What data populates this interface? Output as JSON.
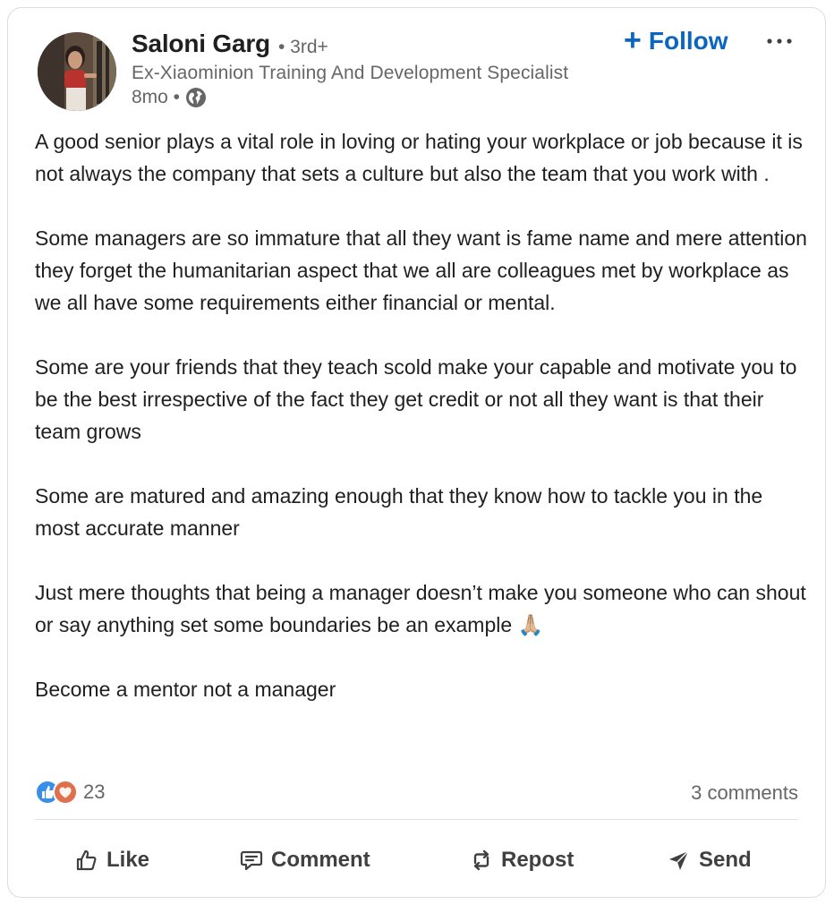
{
  "author": {
    "name": "Saloni Garg",
    "degree": "• 3rd+",
    "headline": "Ex-Xiaominion Training And Development Specialist",
    "time": "8mo •",
    "visibility_icon": "globe-icon"
  },
  "follow": {
    "label": "Follow",
    "icon": "plus-icon"
  },
  "more": {
    "icon": "ellipsis-icon"
  },
  "post": {
    "paragraphs": [
      "A good senior plays a vital role in loving or hating your workplace or job because it is not always the company that sets a culture but also the team that you work with .",
      "Some managers are so immature that all they want is fame name and mere attention they forget the humanitarian aspect that we all are colleagues met by workplace as we all have some requirements either financial or mental.",
      "Some are your friends that they teach scold make your capable and motivate you to be the best irrespective of the fact they get credit or not all they want is that their team grows",
      "Some are matured and amazing enough that they know how to tackle you in the most accurate manner",
      "Just mere thoughts that being a manager doesn’t make you someone who can shout or say anything set some boundaries be an example 🙏🏼",
      "Become a mentor not a manager"
    ]
  },
  "social": {
    "reaction_count": "23",
    "reaction_icons": [
      "like-reaction-icon",
      "love-reaction-icon"
    ],
    "comments": "3 comments"
  },
  "actions": {
    "like": "Like",
    "comment": "Comment",
    "repost": "Repost",
    "send": "Send"
  },
  "colors": {
    "accent": "#0a66c2",
    "text": "#1f1f1f",
    "muted": "#666666",
    "border": "#dcdcdc"
  }
}
